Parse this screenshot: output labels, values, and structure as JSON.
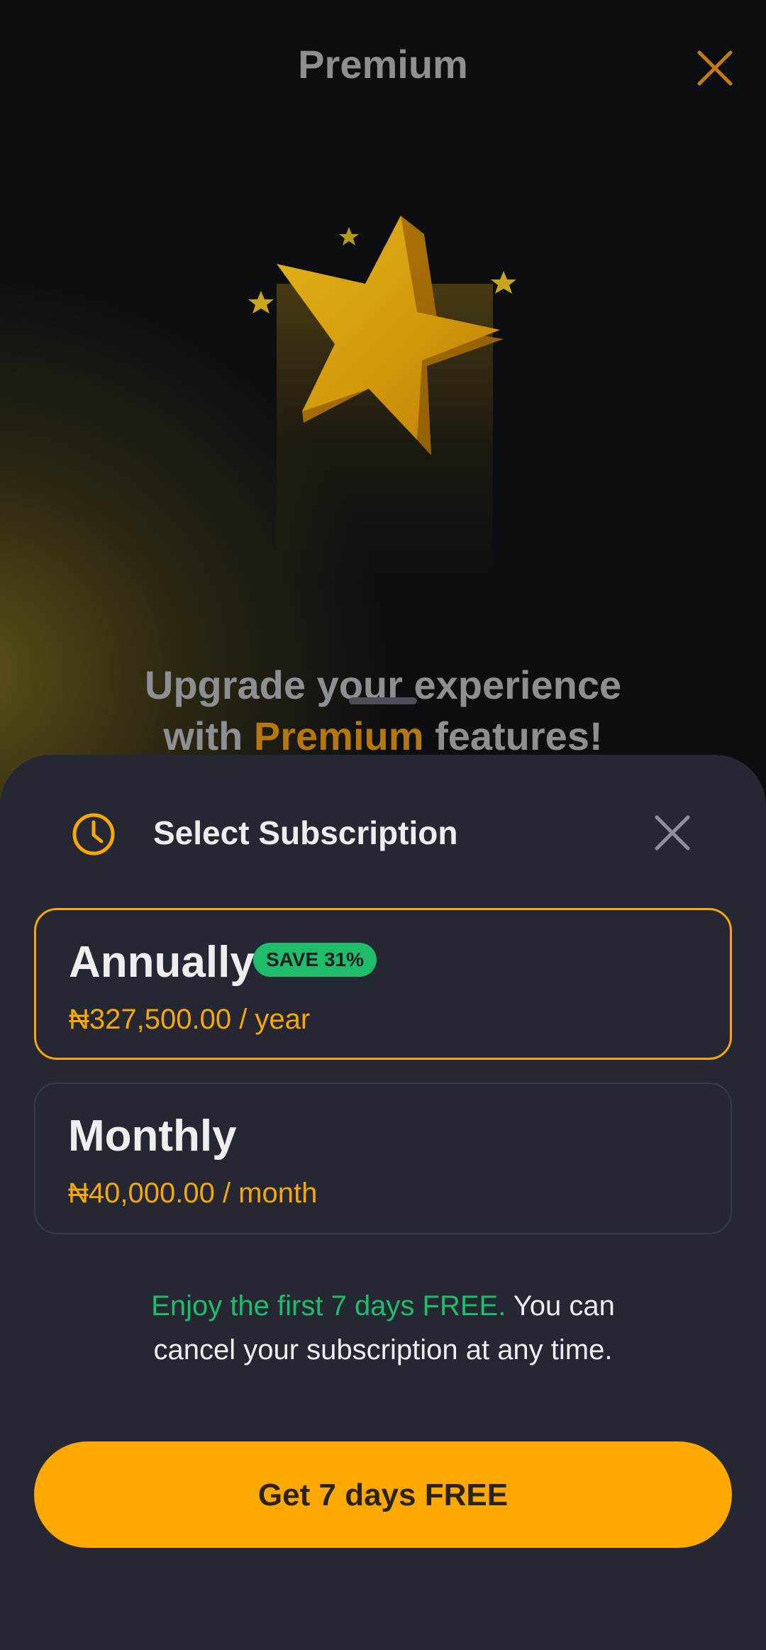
{
  "header": {
    "title": "Premium",
    "close_icon": "close-icon",
    "close_color": "#c47f10"
  },
  "hero": {
    "icon": "star-icon",
    "line1_prefix": "Upgrade your experience",
    "line2_prefix": "with ",
    "line2_accent": "Premium",
    "line2_suffix": " features!"
  },
  "sheet": {
    "icon": "clock-icon",
    "title": "Select Subscription",
    "close_icon": "close-icon"
  },
  "plans": [
    {
      "name": "Annually",
      "badge": "SAVE 31%",
      "price": "₦327,500.00 / year",
      "selected": true
    },
    {
      "name": "Monthly",
      "price": "₦40,000.00 / month",
      "selected": false
    }
  ],
  "trial_note": {
    "highlight": "Enjoy the first 7 days FREE.",
    "rest_line1": " You can",
    "rest_line2": "cancel your subscription at any time."
  },
  "cta": {
    "label": "Get 7 days FREE"
  },
  "colors": {
    "accent": "#f5a806",
    "cta": "#fea802",
    "green": "#1fbd6b",
    "sheet_bg": "#252833",
    "page_bg": "#0d0e11"
  }
}
